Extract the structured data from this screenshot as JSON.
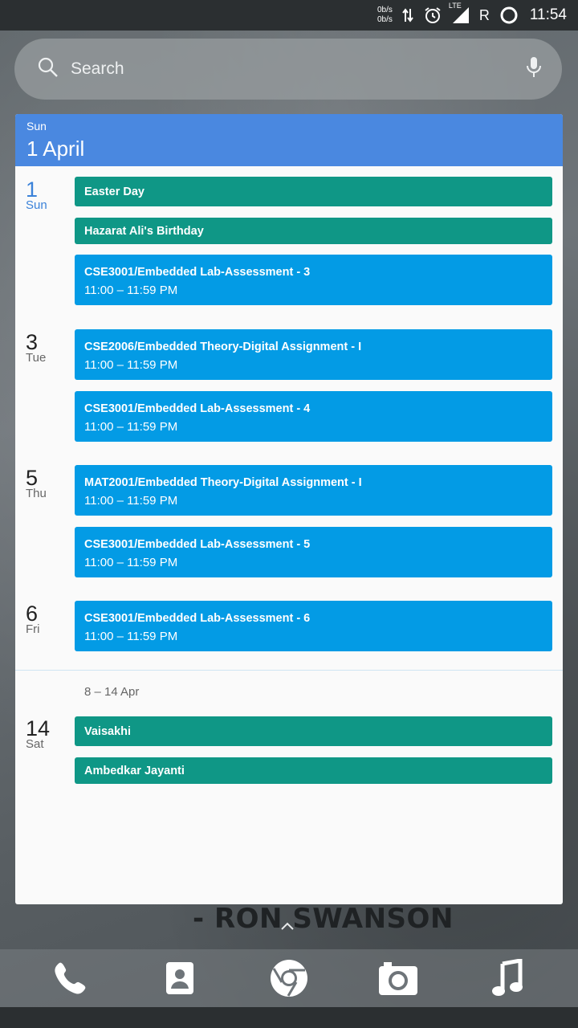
{
  "status_bar": {
    "net_up": "0b/s",
    "net_down": "0b/s",
    "network_type": "LTE",
    "roaming": "R",
    "time": "11:54",
    "icons": [
      "data-arrows-icon",
      "alarm-icon",
      "signal-icon",
      "battery-icon"
    ]
  },
  "search": {
    "placeholder": "Search",
    "icons": [
      "search-icon",
      "mic-icon"
    ]
  },
  "calendar": {
    "header_day": "Sun",
    "header_date": "1 April",
    "days": [
      {
        "num": "1",
        "name": "Sun",
        "today": true,
        "events": [
          {
            "title": "Easter Day",
            "time": "",
            "color": "#0f9786"
          },
          {
            "title": "Hazarat Ali's Birthday",
            "time": "",
            "color": "#0f9786"
          },
          {
            "title": "CSE3001/Embedded Lab-Assessment - 3",
            "time": "11:00 – 11:59 PM",
            "color": "#039be5"
          }
        ]
      },
      {
        "num": "3",
        "name": "Tue",
        "events": [
          {
            "title": "CSE2006/Embedded Theory-Digital Assignment - I",
            "time": "11:00 – 11:59 PM",
            "color": "#039be5"
          },
          {
            "title": "CSE3001/Embedded Lab-Assessment - 4",
            "time": "11:00 – 11:59 PM",
            "color": "#039be5"
          }
        ]
      },
      {
        "num": "5",
        "name": "Thu",
        "events": [
          {
            "title": "MAT2001/Embedded Theory-Digital Assignment - I",
            "time": "11:00 – 11:59 PM",
            "color": "#039be5"
          },
          {
            "title": "CSE3001/Embedded Lab-Assessment - 5",
            "time": "11:00 – 11:59 PM",
            "color": "#039be5"
          }
        ]
      },
      {
        "num": "6",
        "name": "Fri",
        "events": [
          {
            "title": "CSE3001/Embedded Lab-Assessment - 6",
            "time": "11:00 – 11:59 PM",
            "color": "#039be5"
          }
        ]
      }
    ],
    "week_range": "8 – 14 Apr",
    "next_days": [
      {
        "num": "14",
        "name": "Sat",
        "events": [
          {
            "title": "Vaisakhi",
            "time": "",
            "color": "#0f9786"
          },
          {
            "title": "Ambedkar Jayanti",
            "time": "",
            "color": "#0f9786"
          }
        ]
      }
    ]
  },
  "wallpaper_quote": "- RON SWANSON",
  "dock": [
    "phone-icon",
    "contacts-icon",
    "chrome-icon",
    "camera-icon",
    "music-icon"
  ]
}
